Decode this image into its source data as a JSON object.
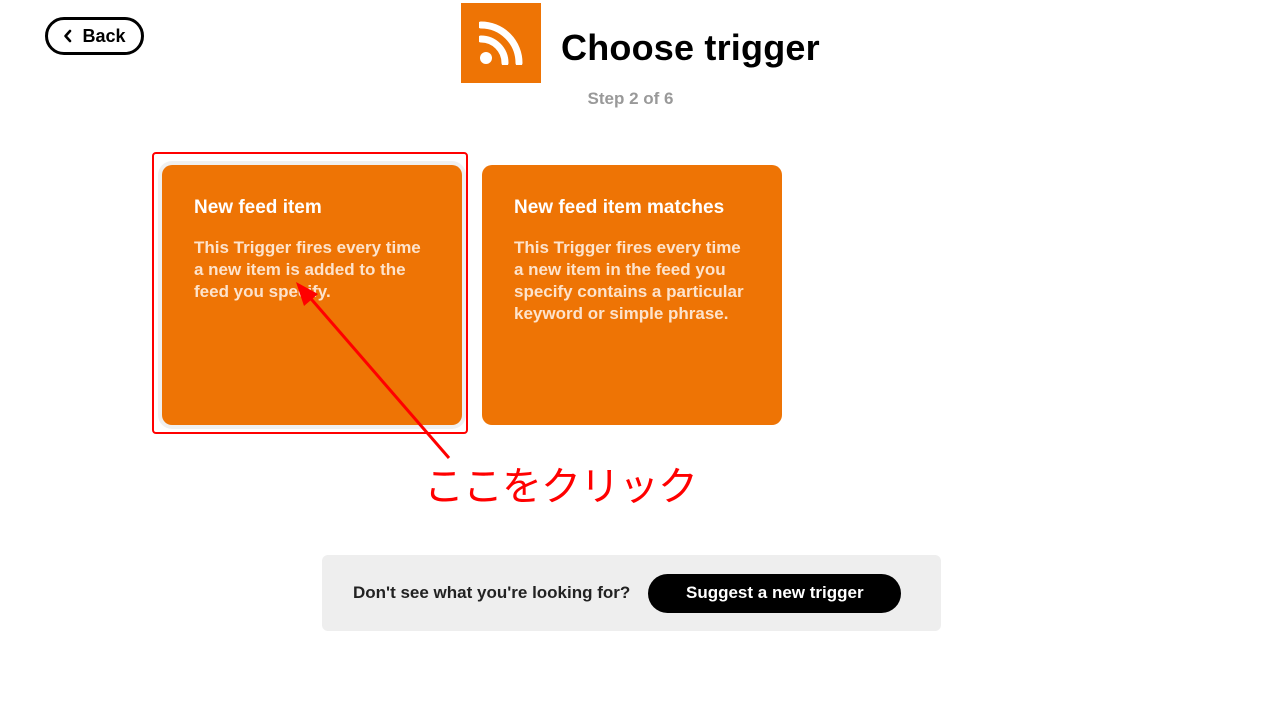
{
  "header": {
    "back_label": "Back",
    "title": "Choose trigger",
    "step": "Step 2 of 6",
    "service_icon": "rss-feed-icon"
  },
  "triggers": [
    {
      "title": "New feed item",
      "description": "This Trigger fires every time a new item is added to the feed you specify."
    },
    {
      "title": "New feed item matches",
      "description": "This Trigger fires every time a new item in the feed you specify contains a particular keyword or simple phrase."
    }
  ],
  "annotation": {
    "text": "ここをクリック",
    "color": "#ff0000"
  },
  "suggest": {
    "prompt": "Don't see what you're looking for?",
    "button_label": "Suggest a new trigger"
  },
  "colors": {
    "brand": "#ee7405",
    "annotation": "#ff0000"
  }
}
